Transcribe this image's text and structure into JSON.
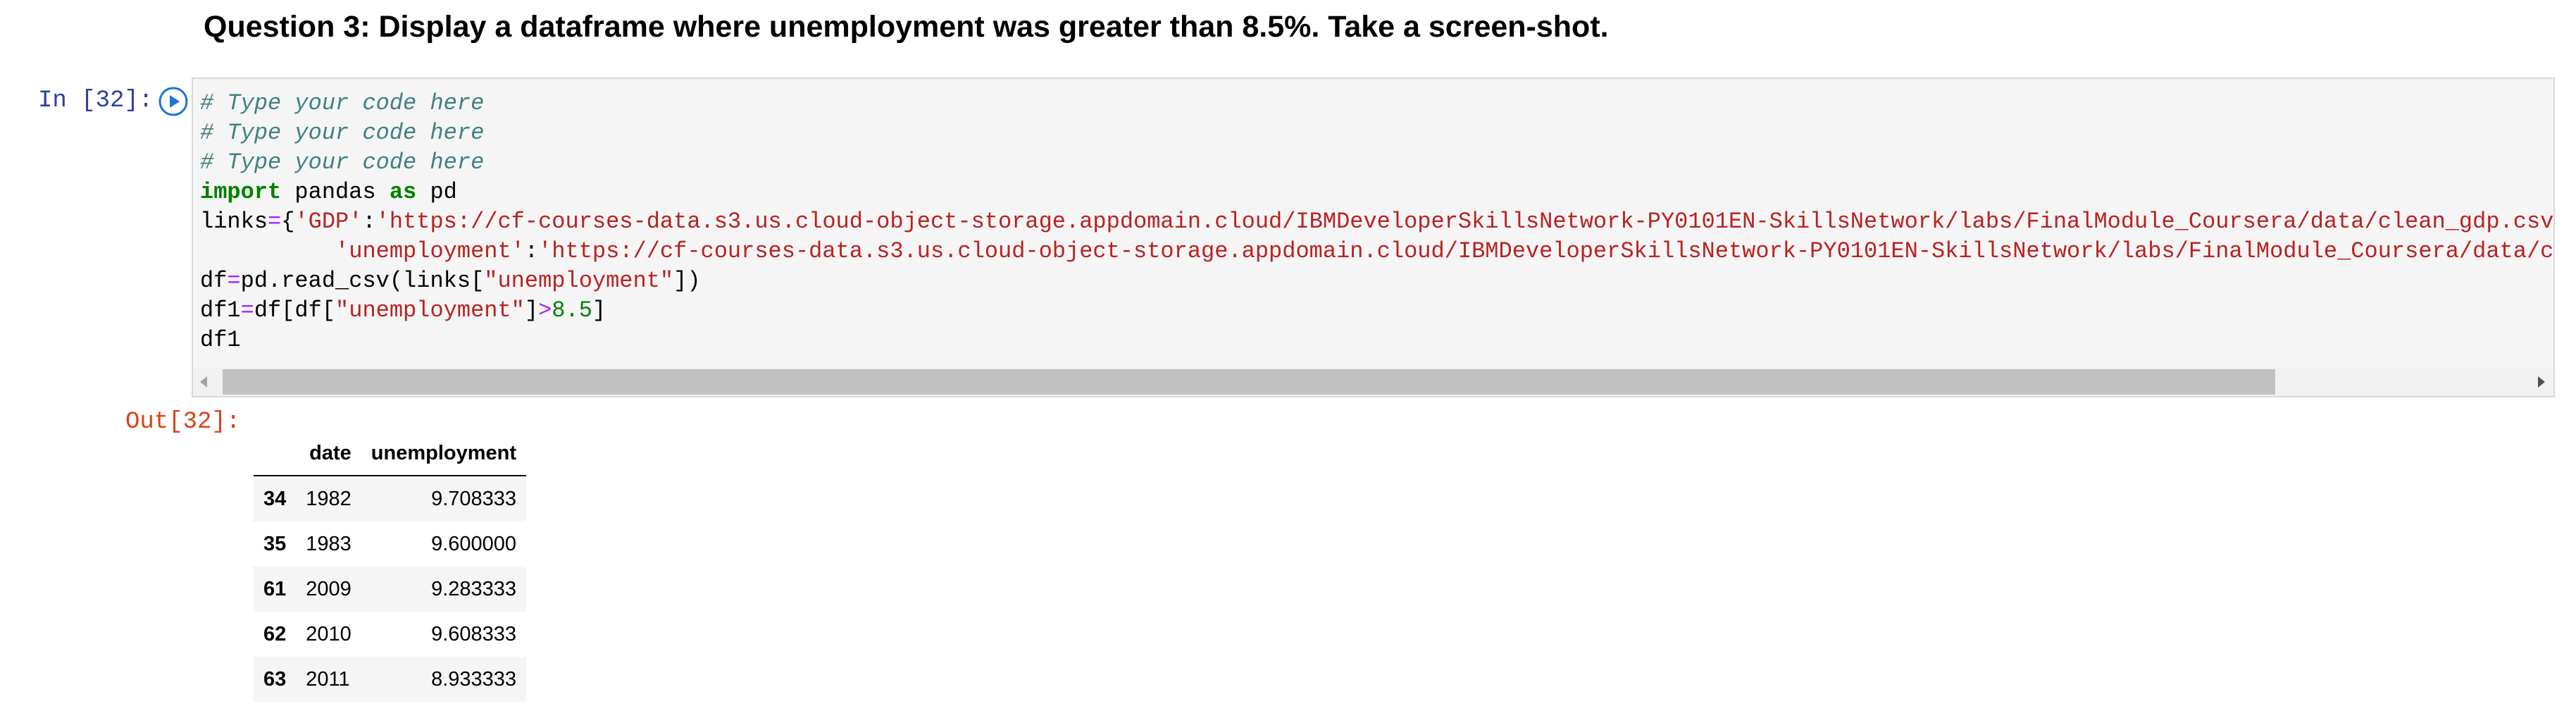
{
  "heading": "Question 3: Display a dataframe where unemployment was greater than 8.5%. Take a screen-shot.",
  "input_prompt": "In [32]:",
  "output_prompt": "Out[32]:",
  "code": {
    "comment1": "# Type your code here",
    "comment2": "# Type your code here",
    "comment3": "# Type your code here",
    "import_kw": "import",
    "import_mod": " pandas ",
    "as_kw": "as",
    "import_alias": " pd",
    "links_var": "links",
    "eq": "=",
    "brace_open": "{",
    "key_gdp": "'GDP'",
    "colon": ":",
    "url_gdp": "'https://cf-courses-data.s3.us.cloud-object-storage.appdomain.cloud/IBMDeveloperSkillsNetwork-PY0101EN-SkillsNetwork/labs/FinalModule_Coursera/data/clean_gdp.csv",
    "indent": "          ",
    "key_unemp": "'unemployment'",
    "url_unemp": "'https://cf-courses-data.s3.us.cloud-object-storage.appdomain.cloud/IBMDeveloperSkillsNetwork-PY0101EN-SkillsNetwork/labs/FinalModule_Coursera/data/clea",
    "df_var": "df",
    "read_call": "pd.read_csv(links[",
    "read_key": "\"unemployment\"",
    "read_close": "])",
    "df1_var": "df1",
    "filter_open": "df[df[",
    "filter_key": "\"unemployment\"",
    "filter_bracket": "]",
    "gt": ">",
    "threshold": "8.5",
    "filter_close": "]",
    "last_line": "df1"
  },
  "table": {
    "columns": [
      "date",
      "unemployment"
    ],
    "rows": [
      {
        "index": "34",
        "date": "1982",
        "unemployment": "9.708333"
      },
      {
        "index": "35",
        "date": "1983",
        "unemployment": "9.600000"
      },
      {
        "index": "61",
        "date": "2009",
        "unemployment": "9.283333"
      },
      {
        "index": "62",
        "date": "2010",
        "unemployment": "9.608333"
      },
      {
        "index": "63",
        "date": "2011",
        "unemployment": "8.933333"
      }
    ]
  },
  "colors": {
    "in_prompt": "#303f9f",
    "out_prompt": "#d84315",
    "run_icon": "#1976d2",
    "cell_background": "#f5f5f5"
  },
  "icons": {
    "run": "run-cell-icon",
    "scroll_left": "scroll-left-arrow-icon",
    "scroll_right": "scroll-right-arrow-icon"
  }
}
